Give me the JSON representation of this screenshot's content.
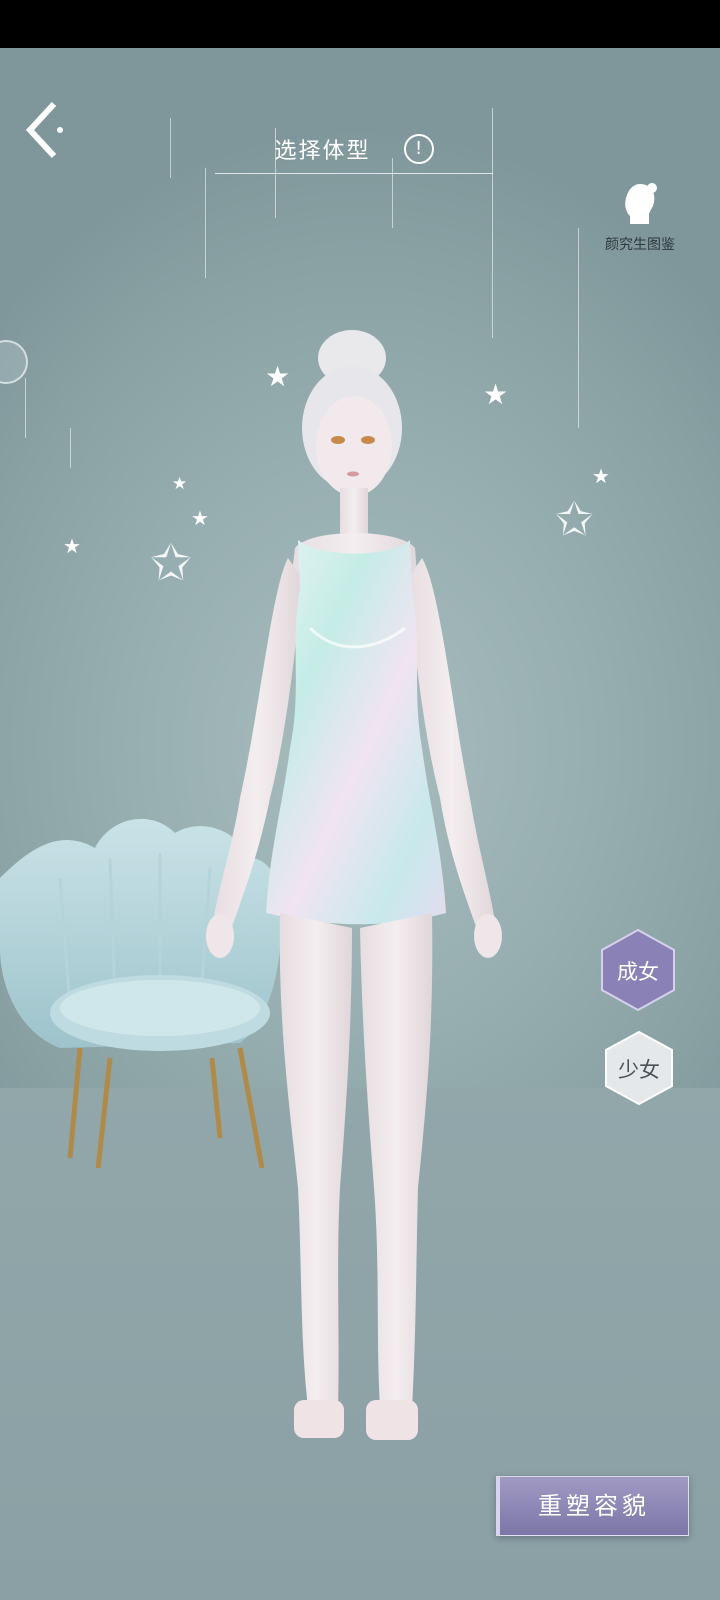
{
  "header": {
    "title": "选择体型",
    "info_icon": "!"
  },
  "prototype": {
    "label": "颜究生图鉴"
  },
  "body_types": [
    {
      "label": "成女",
      "selected": true
    },
    {
      "label": "少女",
      "selected": false
    }
  ],
  "action": {
    "label": "重塑容貌"
  },
  "colors": {
    "background": "#98afb1",
    "accent": "#7c76a8",
    "text": "#ffffff"
  }
}
